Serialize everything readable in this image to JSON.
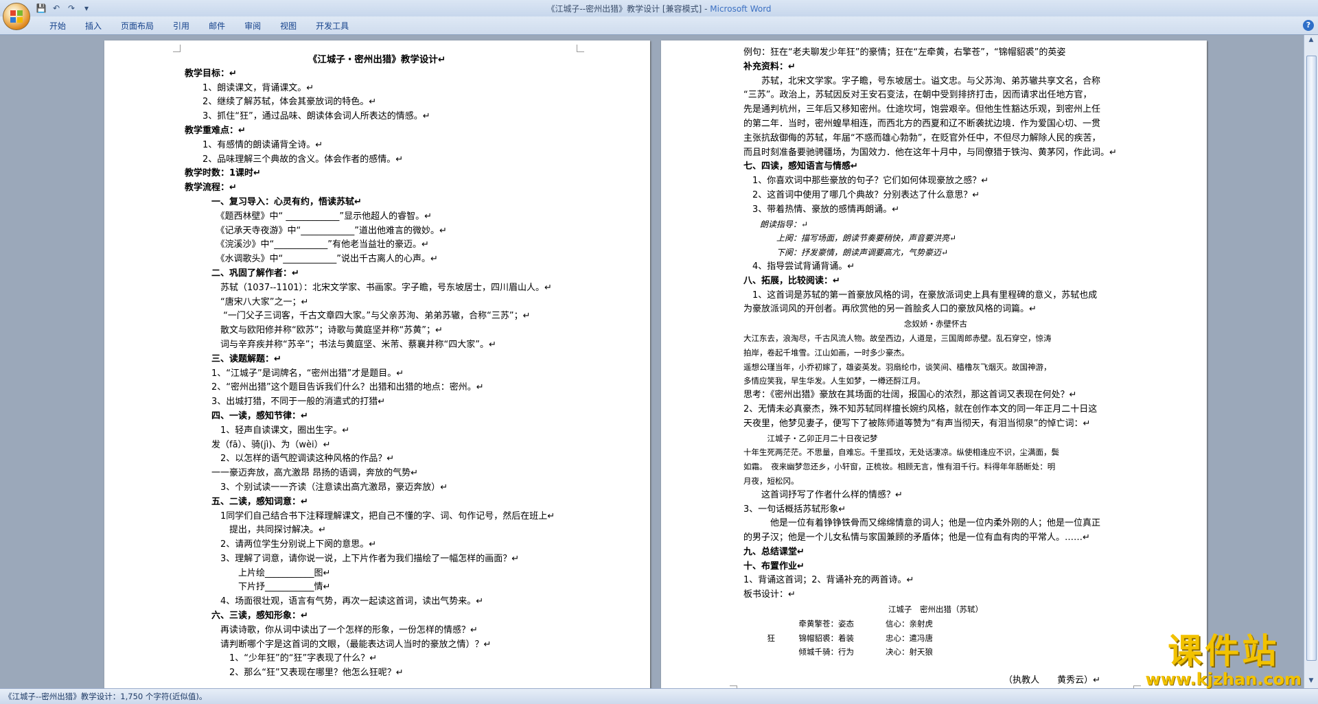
{
  "window": {
    "title": "《江城子--密州出猎》教学设计 [兼容模式] - ",
    "app": "Microsoft Word"
  },
  "qat": {
    "save": "💾",
    "undo": "↶",
    "redo": "↷",
    "more": "▾"
  },
  "ribbon": {
    "tabs": [
      "开始",
      "插入",
      "页面布局",
      "引用",
      "邮件",
      "审阅",
      "视图",
      "开发工具"
    ],
    "help": "?"
  },
  "page1": [
    {
      "text": "《江城子・密州出猎》教学设计↵",
      "style": "t"
    },
    {
      "text": "教学目标：↵",
      "style": "b"
    },
    {
      "text": "　　1、朗读课文，背诵课文。↵"
    },
    {
      "text": "　　2、继续了解苏轼，体会其豪放词的特色。↵"
    },
    {
      "text": "　　3、抓住“狂”，通过品味、朗读体会词人所表达的情感。↵"
    },
    {
      "text": "教学重难点：↵",
      "style": "b"
    },
    {
      "text": "　　1、有感情的朗读诵背全诗。↵"
    },
    {
      "text": "　　2、品味理解三个典故的含义。体会作者的感情。↵"
    },
    {
      "text": "教学时数：1课时↵",
      "style": "b"
    },
    {
      "text": "教学流程：↵",
      "style": "b"
    },
    {
      "text": "　　　一、复习导入：心灵有约，悟读苏轼↵",
      "style": "b"
    },
    {
      "text": "　　　　《题西林壁》中“ ____________”显示他超人的睿智。↵"
    },
    {
      "text": "　　　　《记承天寺夜游》中“____________”道出他难言的微妙。↵"
    },
    {
      "text": "　　　　《浣溪沙》中“____________”有他老当益壮的豪迈。↵"
    },
    {
      "text": "　　　　《水调歌头》中“____________”说出千古离人的心声。↵"
    },
    {
      "text": "　　　二、巩固了解作者：↵",
      "style": "b"
    },
    {
      "text": "　　　　苏轼（1037--1101）：北宋文学家、书画家。字子瞻，号东坡居士，四川眉山人。↵"
    },
    {
      "text": "　　　　“唐宋八大家”之一；↵"
    },
    {
      "text": "　　　　 “一门父子三词客，千古文章四大家。”与父亲苏洵、弟弟苏辙，合称“三苏”；↵"
    },
    {
      "text": "　　　　散文与欧阳修并称“欧苏”；诗歌与黄庭坚并称“苏黄”；↵"
    },
    {
      "text": "　　　　词与辛弃疾并称“苏辛”；书法与黄庭坚、米芾、蔡襄并称“四大家”。↵"
    },
    {
      "text": "　　　三、读题解题：↵",
      "style": "b"
    },
    {
      "text": "　　　1、“江城子”是词牌名，“密州出猎”才是题目。↵"
    },
    {
      "text": "　　　2、“密州出猎”这个题目告诉我们什么？出猎和出猎的地点：密州。↵"
    },
    {
      "text": "　　　3、出城打猎，不同于一般的消遣式的打猎↵"
    },
    {
      "text": "　　　四、一读，感知节律：↵",
      "style": "b"
    },
    {
      "text": "　　　　1、轻声自读课文，圈出生字。↵"
    },
    {
      "text": "　　　发（fā）、骑(jì)、为（wèi）↵"
    },
    {
      "text": "　　　　2、以怎样的语气腔调读这种风格的作品？↵"
    },
    {
      "text": "　　　一一豪迈奔放，高亢激昂 昂扬的语调，奔放的气势↵"
    },
    {
      "text": "　　　　3、个别试读一一齐读（注意读出高亢激昂，豪迈奔放）↵"
    },
    {
      "text": "　　　五、二读，感知词意：↵",
      "style": "b"
    },
    {
      "text": "　　　　1同学们自己结合书下注释理解课文，把自己不懂的字、词、句作记号，然后在班上↵"
    },
    {
      "text": "　　　　　提出，共同探讨解决。↵"
    },
    {
      "text": "　　　　2、请两位学生分别说上下阕的意思。↵"
    },
    {
      "text": "　　　　3、理解了词意，请你说一说，上下片作者为我们描绘了一幅怎样的画面？↵"
    },
    {
      "text": "　　　　　　上片绘___________图↵"
    },
    {
      "text": "　　　　　　下片抒___________情↵"
    },
    {
      "text": "　　　　4、场面很壮观，语言有气势，再次一起读这首词，读出气势来。↵"
    },
    {
      "text": "　　　六、三读，感知形象：↵",
      "style": "b"
    },
    {
      "text": "　　　　再读诗歌，你从词中读出了一个怎样的形象，一份怎样的情感？↵"
    },
    {
      "text": "　　　　请判断哪个字是这首词的文眼，（最能表达词人当时的豪放之情）？↵"
    },
    {
      "text": "　　　　　1、“少年狂”的“狂”字表现了什么？↵"
    },
    {
      "text": "　　　　　2、那么“狂”又表现在哪里？他怎么狂呢？↵"
    }
  ],
  "page2": [
    {
      "text": "例句：狂在“老夫聊发少年狂”的豪情；狂在“左牵黄，右擎苍”，“锦帽貂裘”的英姿"
    },
    {
      "text": "补充资料：↵",
      "style": "b"
    },
    {
      "text": "　　苏轼，北宋文学家。字子瞻，号东坡居士。谥文忠。与父苏洵、弟苏辙共享文名，合称"
    },
    {
      "text": "“三苏”。政治上，苏轼因反对王安石变法，在朝中受到排挤打击，因而请求出任地方官，"
    },
    {
      "text": "先是通判杭州，三年后又移知密州。仕途坎坷，饱尝艰辛。但他生性豁达乐观，到密州上任"
    },
    {
      "text": "的第二年．当时，密州蝗旱相连，而西北方的西夏和辽不断袭扰边境．作为爱国心切、一贯"
    },
    {
      "text": "主张抗敌御侮的苏轼，年届“不惑而雄心勃勃”，在贬官外任中，不但尽力解除人民的疾苦，"
    },
    {
      "text": "而且时刻准备要驰骋疆场，为国效力．他在这年十月中，与同僚猎于铁沟、黄茅冈，作此词。↵"
    },
    {
      "text": "七、四读，感知语言与情感↵",
      "style": "b"
    },
    {
      "text": "　1、你喜欢词中那些豪放的句子？它们如何体现豪放之感？↵"
    },
    {
      "text": "　2、这首词中使用了哪几个典故？分别表达了什么意思？↵"
    },
    {
      "text": "　3、带着热情、豪放的感情再朗诵。↵"
    },
    {
      "text": "　　朗读指导：↵",
      "style": "it"
    },
    {
      "text": "　　　　上阕：描写场面，朗读节奏要稍快，声音要洪亮↵",
      "style": "it"
    },
    {
      "text": "　　　　下阕：抒发豪情，朗读声调要高亢，气势豪迈↵",
      "style": "it"
    },
    {
      "text": "　4、指导尝试背诵背诵。↵"
    },
    {
      "text": "八、拓展，比较阅读：↵",
      "style": "b"
    },
    {
      "text": "　1、这首词是苏轼的第一首豪放风格的词，在豪放派词史上具有里程碑的意义，苏轼也成"
    },
    {
      "text": "为豪放派词风的开创者。再欣赏他的另一首脍炙人口的豪放风格的词篇。↵"
    },
    {
      "text": "念奴娇・赤壁怀古",
      "style": "smc"
    },
    {
      "text": "大江东去，浪淘尽，千古风流人物。故垒西边，人道是，三国周郎赤壁。乱石穿空，惊涛",
      "style": "sm"
    },
    {
      "text": "拍岸，卷起千堆雪。江山如画，一时多少豪杰。",
      "style": "sm"
    },
    {
      "text": "遥想公瑾当年，小乔初嫁了，雄姿英发。羽扇纶巾，谈笑间、樯橹灰飞烟灭。故国神游，",
      "style": "sm"
    },
    {
      "text": "多情应笑我，早生华发。人生如梦，一樽还酹江月。",
      "style": "sm"
    },
    {
      "text": "思考：《密州出猎》豪放在其场面的壮阔，报国心的浓烈，那这首词又表现在何处？↵"
    },
    {
      "text": "2、无情未必真豪杰，殊不知苏轼同样擅长婉约风格，就在创作本文的同一年正月二十日这"
    },
    {
      "text": "天夜里，他梦见妻子，便写下了被陈师道等赞为“有声当彻天，有泪当彻泉”的悼亡词：↵"
    },
    {
      "text": "　　　江城子・乙卯正月二十日夜记梦",
      "style": "sm"
    },
    {
      "text": "十年生死两茫茫。不思量，自难忘。千里孤坟，无处话凄凉。纵使相逢应不识，尘满面，鬓",
      "style": "sm"
    },
    {
      "text": "如霜。　夜来幽梦忽还乡，小轩窗，正梳妆。相顾无言，惟有泪千行。料得年年肠断处：明",
      "style": "sm"
    },
    {
      "text": "月夜，短松冈。",
      "style": "sm"
    },
    {
      "text": "　　这首词抒写了作者什么样的情感？↵"
    },
    {
      "text": "3、一句话概括苏轼形象↵"
    },
    {
      "text": "　　　他是一位有着铮铮铁骨而又绵绵情意的词人；他是一位内柔外刚的人；他是一位真正"
    },
    {
      "text": "的男子汉；他是一个儿女私情与家国兼顾的矛盾体；他是一位有血有肉的平常人。……↵"
    },
    {
      "text": "九、总结课堂↵",
      "style": "b"
    },
    {
      "text": "十、布置作业↵",
      "style": "b"
    },
    {
      "text": "1、背诵这首词；2、背诵补充的两首诗。↵"
    },
    {
      "text": "板书设计：↵"
    },
    {
      "text": "江城子　密州出猎（苏轼）",
      "style": "smc"
    },
    {
      "text": "　　　　　　　牵黄擎苍：姿态　　　　信心：亲射虎",
      "style": "sm"
    },
    {
      "text": "　　　狂　　　锦帽貂裘：着装　　　　忠心：遣冯唐",
      "style": "sm"
    },
    {
      "text": "　　　　　　　倾城千骑：行为　　　　决心：射天狼",
      "style": "sm"
    },
    {
      "text": "",
      "style": "sm"
    },
    {
      "text": "（执教人　　黄秀云）↵",
      "style": "r"
    }
  ],
  "status": {
    "text": "《江城子--密州出猎》教学设计：1,750 个字符(近似值)。"
  },
  "watermark": {
    "big": "课件站",
    "url": "www.kjzhan.com"
  }
}
